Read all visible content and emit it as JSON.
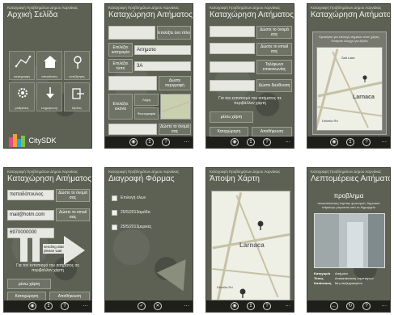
{
  "common": {
    "app_subtitle": "Καταγραφή Προβλημάτων Δήμου Λαρνάκας",
    "more_dots": "..."
  },
  "screen1": {
    "title": "Αρχική Σελίδα",
    "tiles": [
      "καταγραφή",
      "απεικόνιση",
      "αναζήτηση",
      "ρυθμίσεις",
      "ενημέρωση",
      "έξοδος"
    ],
    "brand": "CitySDK"
  },
  "screen2": {
    "title": "Καταχώρηση Αιτήματος",
    "add_title": "Επιλέξτε ένα τίτλο",
    "choose_category": "Επιλέξτε κατηγορία",
    "category_value": "Αιτηματα",
    "choose_type": "Επιλέξτε τύπο",
    "type_value": "3A",
    "give_description": "Δώστε περιγραφή",
    "choose_photo": "Επιλέξτε εικόνα",
    "photo_option_1": "Λήψη",
    "photo_option_2": "Φωτογραφία",
    "give_name": "Δώστε το όνομά σας"
  },
  "screen3": {
    "title": "Καταχώρηση Αιτήματος",
    "give_name": "Δώστε το όνομά σας",
    "give_email": "Δώστε το email σας",
    "give_phone": "Τηλέφωνο επικοινωνίας",
    "give_address": "Δώστε διεύθυνση",
    "location_hint": "Για τον εντοπισμό του αιτήματος σε περιβάλλον χάρτη",
    "map_button": "μέσω χάρτη",
    "submit": "Καταχώρηση",
    "save": "Αποθήκευση"
  },
  "screen4": {
    "title": "Καταχώρηση Αιτήματος",
    "map_notice": "Κρατήστε για επιλογή σημείου στον χάρτη. Πατήστε έλεγχο για έξοδο",
    "place_1": "Larnaca",
    "place_2": "Salt Lake",
    "place_3": "Dekelia Rd"
  },
  "screen5": {
    "title": "Καταχώρηση Αιτήματος",
    "name_value": "παπαδόπουλος",
    "give_name": "Δώστε το όνομά σας",
    "email_value": "mail@hotm.com",
    "give_email": "Δώστε το email σας",
    "phone_value": "6970000000",
    "sending_text": "sending data please wait",
    "location_hint": "Για τον εντοπισμό του αιτήματος σε περιβάλλον χάρτη",
    "map_button": "μέσω χάρτη",
    "submit": "Καταχώρηση",
    "save": "Αποθήκευση"
  },
  "screen6": {
    "title": "Διαγραφή Φόρμας",
    "items": [
      "Επιλογή όλων",
      "25/5/2013αμάδα",
      "25/5/2013μερικές"
    ]
  },
  "screen7": {
    "title": "Άποψη Χάρτη",
    "place_1": "Larnaca",
    "place_2": "Dekelia Rd"
  },
  "screen8": {
    "title": "Λεπτομέρειες Αιτήματος",
    "problem_heading": "προβλημα",
    "problem_text": "αντικατάσταση λαμπας φωτισμού, δημοτικό πάρκινγκ μπροστά από το δημαρχείο",
    "detail_1_label": "Κατηγορία",
    "detail_1_value": "Αιτήματα",
    "detail_2_label": "Τύπος",
    "detail_2_value": "Αντικατάσταση λαμπτήρων",
    "detail_3_label": "Κατάσταση",
    "detail_3_value": "Μη επεξεργασμένο"
  },
  "icons": [
    "camera-icon",
    "upload-icon",
    "help-icon",
    "check-icon",
    "close-icon",
    "back-icon",
    "refresh-icon",
    "pin-icon"
  ]
}
